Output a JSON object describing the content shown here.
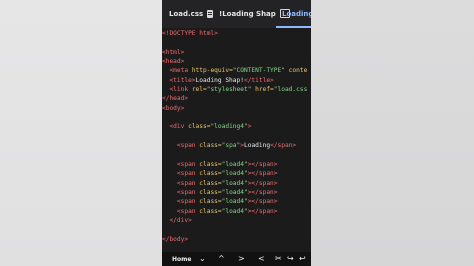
{
  "tabs": [
    {
      "label": "Load.css",
      "icon": "file-icon"
    },
    {
      "label": "!Loading Shap",
      "icon": "browser-icon"
    },
    {
      "label": "Loading .h",
      "icon": ""
    }
  ],
  "code_lines": [
    [
      {
        "t": "tag",
        "v": "<!DOCTYPE html>"
      }
    ],
    [],
    [
      {
        "t": "tag",
        "v": "<html>"
      }
    ],
    [
      {
        "t": "tag",
        "v": "<head>"
      }
    ],
    [
      {
        "t": "txt",
        "v": "  "
      },
      {
        "t": "tag",
        "v": "<meta "
      },
      {
        "t": "attr",
        "v": "http-equiv="
      },
      {
        "t": "str",
        "v": "\"CONTENT-TYPE\""
      },
      {
        "t": "attr",
        "v": " conte"
      }
    ],
    [
      {
        "t": "txt",
        "v": "  "
      },
      {
        "t": "tag",
        "v": "<title>"
      },
      {
        "t": "txt",
        "v": "Loading Shap!"
      },
      {
        "t": "tag",
        "v": "</title>"
      }
    ],
    [
      {
        "t": "txt",
        "v": "  "
      },
      {
        "t": "tag",
        "v": "<link "
      },
      {
        "t": "attr",
        "v": "rel="
      },
      {
        "t": "str",
        "v": "\"stylesheet\""
      },
      {
        "t": "attr",
        "v": " href="
      },
      {
        "t": "str",
        "v": "\"load.css"
      }
    ],
    [
      {
        "t": "tag",
        "v": "</head>"
      }
    ],
    [
      {
        "t": "tag",
        "v": "<body>"
      }
    ],
    [],
    [
      {
        "t": "txt",
        "v": "  "
      },
      {
        "t": "tag",
        "v": "<div "
      },
      {
        "t": "attr",
        "v": "class="
      },
      {
        "t": "str",
        "v": "\"loading4\""
      },
      {
        "t": "tag",
        "v": ">"
      }
    ],
    [],
    [
      {
        "t": "txt",
        "v": "    "
      },
      {
        "t": "tag",
        "v": "<span "
      },
      {
        "t": "attr",
        "v": "class="
      },
      {
        "t": "str",
        "v": "\"spa\""
      },
      {
        "t": "tag",
        "v": ">"
      },
      {
        "t": "txt",
        "v": "Loading"
      },
      {
        "t": "tag",
        "v": "</span>"
      }
    ],
    [],
    [
      {
        "t": "txt",
        "v": "    "
      },
      {
        "t": "tag",
        "v": "<span "
      },
      {
        "t": "attr",
        "v": "class="
      },
      {
        "t": "str",
        "v": "\"load4\""
      },
      {
        "t": "tag",
        "v": "></span>"
      }
    ],
    [
      {
        "t": "txt",
        "v": "    "
      },
      {
        "t": "tag",
        "v": "<span "
      },
      {
        "t": "attr",
        "v": "class="
      },
      {
        "t": "str",
        "v": "\"load4\""
      },
      {
        "t": "tag",
        "v": "></span>"
      }
    ],
    [
      {
        "t": "txt",
        "v": "    "
      },
      {
        "t": "tag",
        "v": "<span "
      },
      {
        "t": "attr",
        "v": "class="
      },
      {
        "t": "str",
        "v": "\"load4\""
      },
      {
        "t": "tag",
        "v": "></span>"
      }
    ],
    [
      {
        "t": "txt",
        "v": "    "
      },
      {
        "t": "tag",
        "v": "<span "
      },
      {
        "t": "attr",
        "v": "class="
      },
      {
        "t": "str",
        "v": "\"load4\""
      },
      {
        "t": "tag",
        "v": "></span>"
      }
    ],
    [
      {
        "t": "txt",
        "v": "    "
      },
      {
        "t": "tag",
        "v": "<span "
      },
      {
        "t": "attr",
        "v": "class="
      },
      {
        "t": "str",
        "v": "\"load4\""
      },
      {
        "t": "tag",
        "v": "></span>"
      }
    ],
    [
      {
        "t": "txt",
        "v": "    "
      },
      {
        "t": "tag",
        "v": "<span "
      },
      {
        "t": "attr",
        "v": "class="
      },
      {
        "t": "str",
        "v": "\"load4\""
      },
      {
        "t": "tag",
        "v": "></span>"
      }
    ],
    [
      {
        "t": "txt",
        "v": "  "
      },
      {
        "t": "tag",
        "v": "</div>"
      }
    ],
    [],
    [
      {
        "t": "tag",
        "v": "</body>"
      }
    ]
  ],
  "bottom_bar": {
    "home_label": "Home",
    "icons": [
      "chevron-down-icon",
      "chevron-up-icon",
      "chevron-right-icon",
      "chevron-left-icon",
      "cut-icon",
      "redo-icon",
      "undo-icon"
    ],
    "glyphs": [
      "⌄",
      "^",
      ">",
      "<",
      "✂",
      "↪",
      "↩"
    ]
  },
  "colors": {
    "tag": "#f06b6b",
    "attr": "#e7c86b",
    "string": "#86d487",
    "background": "#1b1b1c",
    "accent": "#8fb9ff"
  }
}
